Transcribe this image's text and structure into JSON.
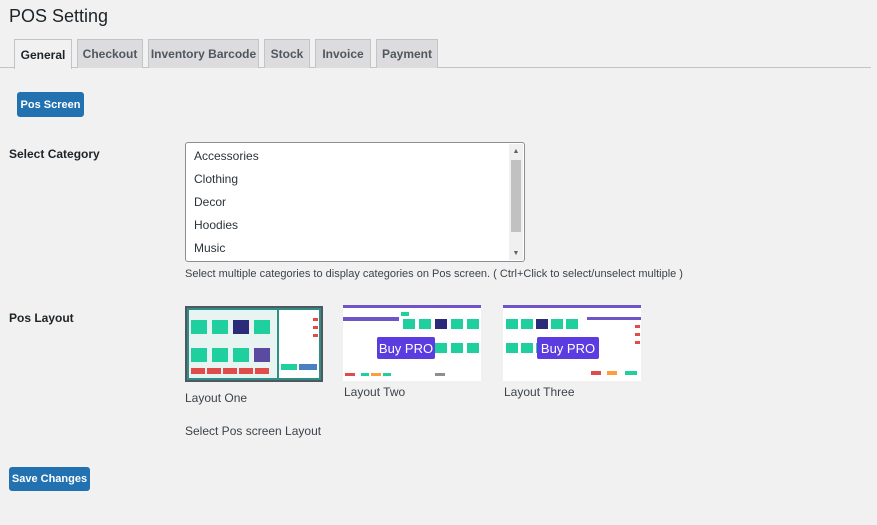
{
  "page": {
    "title": "POS Setting"
  },
  "tabs": [
    {
      "label": "General",
      "active": true
    },
    {
      "label": "Checkout"
    },
    {
      "label": "Inventory Barcode"
    },
    {
      "label": "Stock"
    },
    {
      "label": "Invoice"
    },
    {
      "label": "Payment"
    }
  ],
  "pos_screen_button": "Pos Screen",
  "category": {
    "label": "Select Category",
    "options": [
      "Accessories",
      "Clothing",
      "Decor",
      "Hoodies",
      "Music"
    ],
    "help": "Select multiple categories to display categories on Pos screen. ( Ctrl+Click to select/unselect multiple )"
  },
  "layout": {
    "label": "Pos Layout",
    "options": [
      {
        "name": "Layout One",
        "selected": true
      },
      {
        "name": "Layout Two",
        "badge": "Buy PRO"
      },
      {
        "name": "Layout Three",
        "badge": "Buy PRO"
      }
    ],
    "help": "Select Pos screen Layout"
  },
  "save_button": "Save Changes",
  "colors": {
    "primary": "#2271b1",
    "pro_badge": "#5b3ce0",
    "thumb_teal": "#1fcf9d",
    "thumb_red": "#e04b4b",
    "thumb_purple": "#6f55c8"
  }
}
